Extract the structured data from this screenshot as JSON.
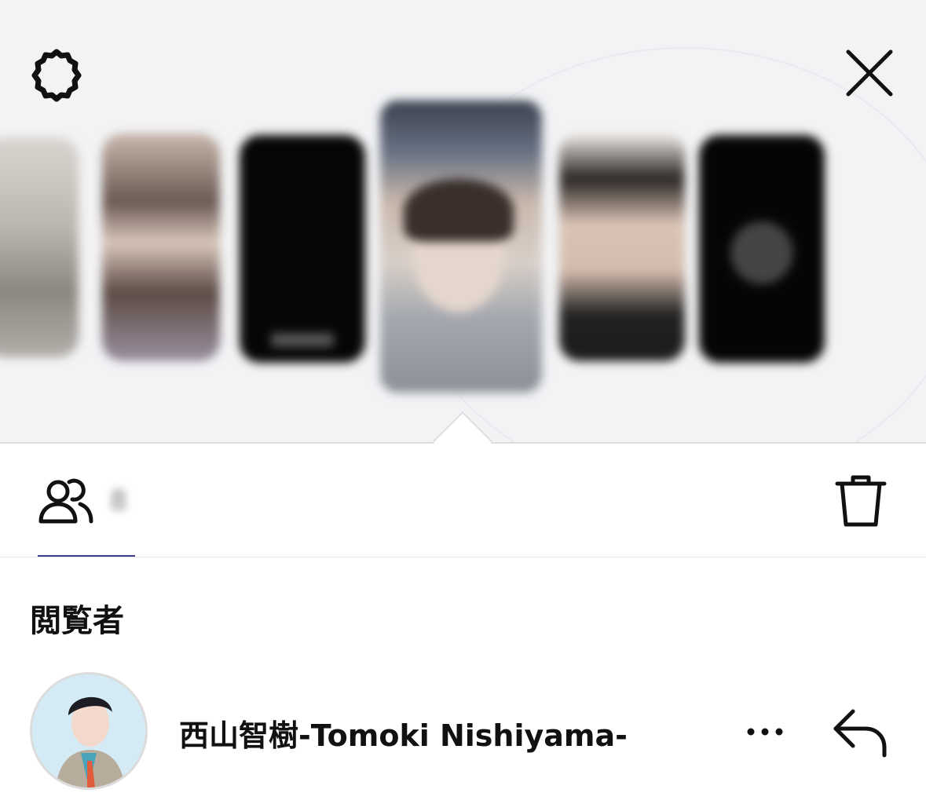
{
  "header": {
    "settings_icon": "gear-icon",
    "close_icon": "close-icon"
  },
  "stories": {
    "thumbnails": [
      {
        "name": "story-thumbnail-1"
      },
      {
        "name": "story-thumbnail-2"
      },
      {
        "name": "story-thumbnail-3"
      },
      {
        "name": "story-thumbnail-4",
        "selected": true
      },
      {
        "name": "story-thumbnail-5"
      },
      {
        "name": "story-thumbnail-6"
      }
    ]
  },
  "toolbar": {
    "viewers_icon": "people-icon",
    "viewer_count": "8",
    "delete_icon": "trash-icon"
  },
  "viewers": {
    "section_title": "閲覧者",
    "items": [
      {
        "name": "西山智樹-Tomoki Nishiyama-",
        "more_icon": "more-icon",
        "reply_icon": "reply-icon"
      }
    ]
  },
  "colors": {
    "panel_bg": "#f2f3f5",
    "tab_underline": "#3d3a8a",
    "text": "#111111"
  }
}
